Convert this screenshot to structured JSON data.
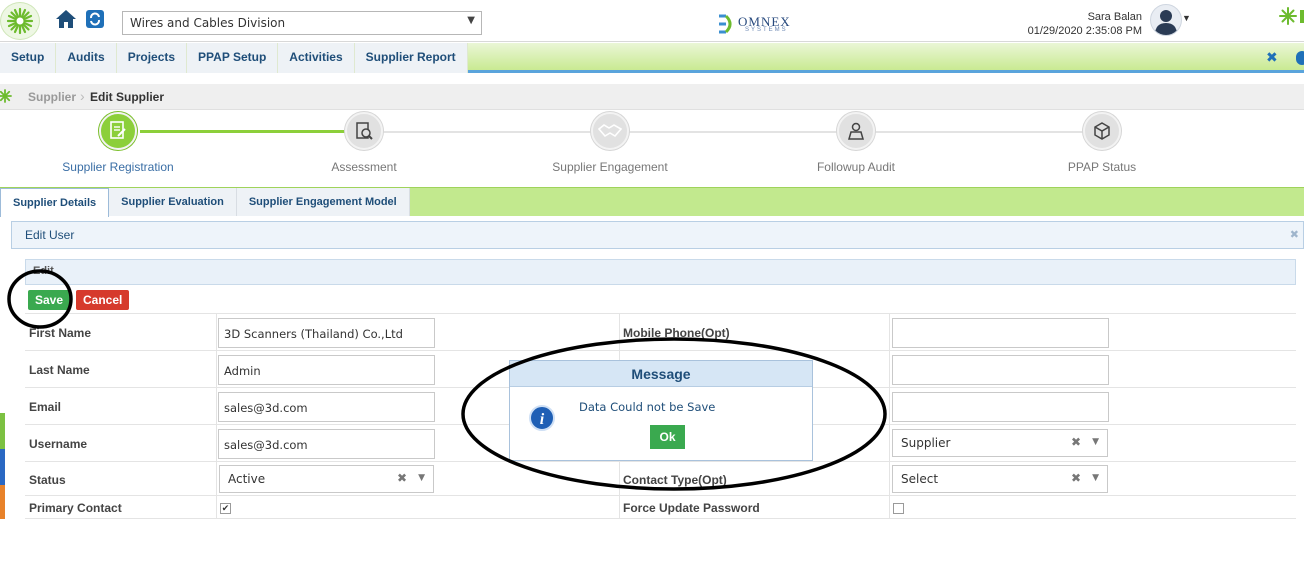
{
  "header": {
    "division": "Wires and Cables Division",
    "brand_name": "OMNEX",
    "brand_sub": "SYSTEMS",
    "user_name": "Sara Balan",
    "datetime": "01/29/2020 2:35:08 PM"
  },
  "main_nav": {
    "items": [
      "Setup",
      "Audits",
      "Projects",
      "PPAP Setup",
      "Activities",
      "Supplier Report"
    ]
  },
  "breadcrumb": {
    "parent": "Supplier",
    "current": "Edit Supplier"
  },
  "stepper": {
    "steps": [
      {
        "label": "Supplier Registration",
        "active": true
      },
      {
        "label": "Assessment",
        "active": false
      },
      {
        "label": "Supplier Engagement",
        "active": false
      },
      {
        "label": "Followup Audit",
        "active": false
      },
      {
        "label": "PPAP Status",
        "active": false
      }
    ]
  },
  "tabs": {
    "items": [
      "Supplier Details",
      "Supplier Evaluation",
      "Supplier Engagement Model"
    ],
    "active": "Supplier Details"
  },
  "panel": {
    "title": "Edit User",
    "inner_title": "Edit",
    "save_label": "Save",
    "cancel_label": "Cancel"
  },
  "form": {
    "first_name": {
      "label": "First Name",
      "value": "3D Scanners (Thailand) Co.,Ltd"
    },
    "last_name": {
      "label": "Last Name",
      "value": "Admin"
    },
    "email": {
      "label": "Email",
      "value": "sales@3d.com"
    },
    "username": {
      "label": "Username",
      "value": "sales@3d.com"
    },
    "status": {
      "label": "Status",
      "value": "Active"
    },
    "primary_contact": {
      "label": "Primary Contact",
      "checked": true
    },
    "mobile_phone": {
      "label": "Mobile Phone(Opt)",
      "value": ""
    },
    "right_row2": {
      "value": ""
    },
    "right_row3": {
      "value": ""
    },
    "role": {
      "value": "Supplier"
    },
    "contact_type": {
      "label": "Contact Type(Opt)",
      "value": "Select"
    },
    "force_update_password": {
      "label": "Force Update Password",
      "checked": false
    }
  },
  "modal": {
    "title": "Message",
    "message": "Data Could not be Save",
    "ok_label": "Ok"
  },
  "colors": {
    "nav_green": "#c9ea92",
    "accent_blue": "#1f4e79",
    "step_active": "#8ccf3a",
    "save_green": "#3aa94f",
    "cancel_red": "#d63a2c",
    "annotation": "#000000"
  }
}
